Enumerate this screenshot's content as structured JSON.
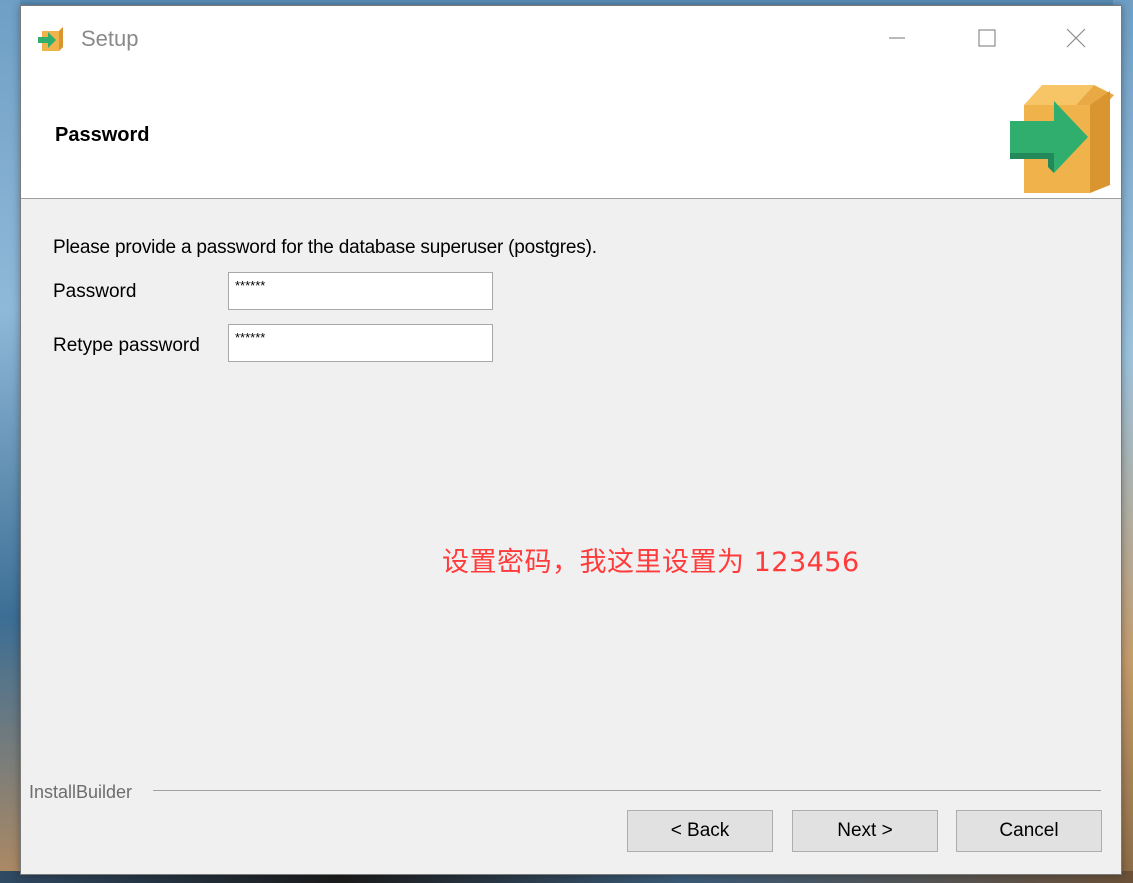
{
  "window": {
    "title": "Setup",
    "icons": {
      "app": "installer-box-arrow-icon",
      "minimize": "minimize-icon",
      "maximize": "maximize-icon",
      "close": "close-icon"
    }
  },
  "header": {
    "title": "Password",
    "logo": "installer-box-arrow-icon"
  },
  "content": {
    "instruction": "Please provide a password for the database superuser (postgres).",
    "fields": [
      {
        "label": "Password",
        "value": "******"
      },
      {
        "label": "Retype password",
        "value": "******"
      }
    ],
    "annotation": "设置密码，我这里设置为 123456"
  },
  "footer": {
    "brand": "InstallBuilder",
    "buttons": {
      "back": "< Back",
      "next": "Next >",
      "cancel": "Cancel"
    }
  },
  "colors": {
    "annotation": "#ff3b3b",
    "box_orange": "#f0b24a",
    "arrow_green": "#2fae6e"
  }
}
